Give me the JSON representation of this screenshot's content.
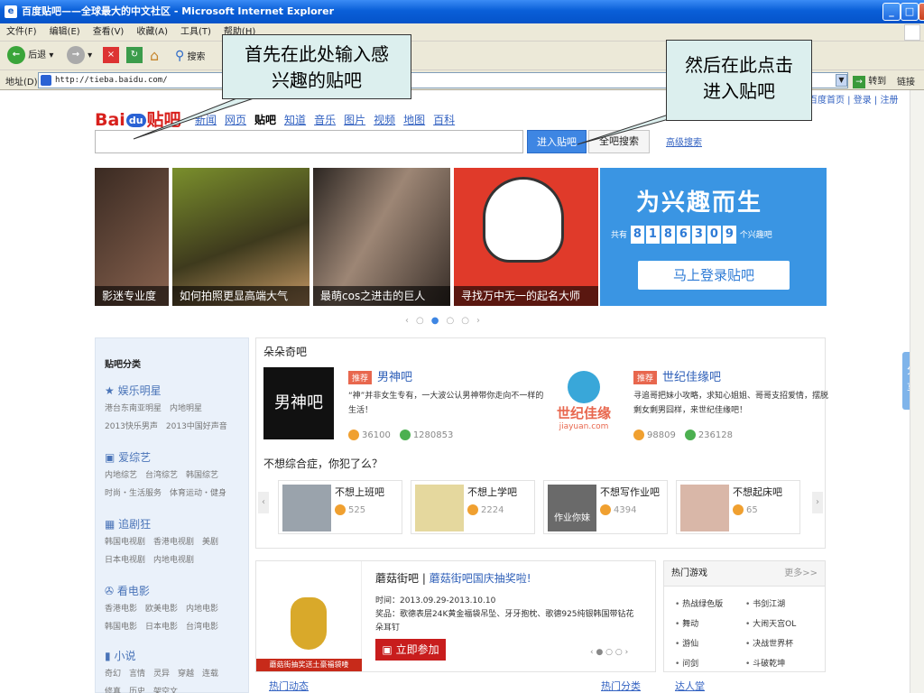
{
  "window": {
    "title": "百度贴吧——全球最大的中文社区 - Microsoft Internet Explorer"
  },
  "menu": [
    "文件(F)",
    "编辑(E)",
    "查看(V)",
    "收藏(A)",
    "工具(T)",
    "帮助(H)"
  ],
  "toolbar": {
    "back": "后退",
    "search": "搜索"
  },
  "address": {
    "label": "地址(D)",
    "url": "http://tieba.baidu.com/",
    "go": "转到",
    "links": "链接"
  },
  "logo": {
    "bai": "Bai",
    "du": "du",
    "tieba": "贴吧"
  },
  "nav": [
    "新闻",
    "网页",
    "贴吧",
    "知道",
    "音乐",
    "图片",
    "视频",
    "地图",
    "百科"
  ],
  "toplinks": "百度首页 | 登录 | 注册",
  "search": {
    "enter": "进入贴吧",
    "all": "全吧搜索",
    "advanced": "高级搜索"
  },
  "slides": [
    "影迷专业度",
    "如何拍照更显高端大气",
    "最萌cos之进击的巨人",
    "寻找万中无一的起名大师"
  ],
  "promo": {
    "headline": "为兴趣而生",
    "prefix": "共有",
    "digits": [
      "8",
      "1",
      "8",
      "6",
      "3",
      "0",
      "9"
    ],
    "suffix": "个兴趣吧",
    "login": "马上登录贴吧"
  },
  "carousel_arrows": {
    "prev": "‹",
    "next": "›"
  },
  "sidebar": {
    "title": "贴吧分类",
    "groups": [
      {
        "title": "娱乐明星",
        "lines": [
          "港台东南亚明星　内地明星",
          "2013快乐男声　2013中国好声音"
        ]
      },
      {
        "title": "爱综艺",
        "lines": [
          "内地综艺　台湾综艺　韩国综艺",
          "时尚・生活服务　体育运动・健身"
        ]
      },
      {
        "title": "追剧狂",
        "lines": [
          "韩国电视剧　香港电视剧　美剧",
          "日本电视剧　内地电视剧"
        ]
      },
      {
        "title": "看电影",
        "lines": [
          "香港电影　欧美电影　内地电影",
          "韩国电影　日本电影　台湾电影"
        ]
      },
      {
        "title": "小说",
        "lines": [
          "奇幻　言情　灵异　穿越　连载",
          "修真　历史　架空文"
        ]
      }
    ]
  },
  "main": {
    "section": "朵朵奇吧",
    "badge": "推荐",
    "featured": [
      {
        "name": "男神吧",
        "thumb": "男神吧",
        "desc": "“神”并非女生专有，一大波公认男神带你走向不一样的生活！",
        "members": "36100",
        "posts": "1280853"
      },
      {
        "name": "世纪佳缘吧",
        "thumb": "世纪佳缘",
        "thumb_sub": "jiayuan.com",
        "desc": "寻追哥把妹小攻略，求知心姐姐、哥哥支招爱情，摆脱剩女剩男囧样，来世纪佳缘吧！",
        "members": "98809",
        "posts": "236128"
      }
    ],
    "subsection": "不想综合症，你犯了么？",
    "cards": [
      {
        "name": "不想上班吧",
        "count": "525"
      },
      {
        "name": "不想上学吧",
        "count": "2224"
      },
      {
        "name": "不想写作业吧",
        "count": "4394",
        "thumb": "作业你妹"
      },
      {
        "name": "不想起床吧",
        "count": "65"
      }
    ]
  },
  "event": {
    "title": "蘑菇街吧",
    "subtitle": "蘑菇街吧国庆抽奖啦!",
    "time": "时间：2013.09.29-2013.10.10",
    "prize": "奖品：歌德表层24K黄金福袋吊坠、牙牙抱枕、歌德925纯银韩国带钻花朵耳钉",
    "join": "立即参加",
    "thumb_caption": "蘑菇街抽奖送土豪福袋喽"
  },
  "hot": {
    "title": "热门游戏",
    "more": "更多>>",
    "items": [
      "热战绿色版",
      "书剑江湖",
      "舞动",
      "大闹天宫OL",
      "游仙",
      "决战世界杯",
      "问剑",
      "斗破乾坤"
    ]
  },
  "bottom": [
    "热门动态",
    "热门分类",
    "达人堂"
  ],
  "share": "分享",
  "callouts": {
    "left": "首先在此处输入感兴趣的贴吧",
    "right": "然后在此点击进入贴吧"
  }
}
